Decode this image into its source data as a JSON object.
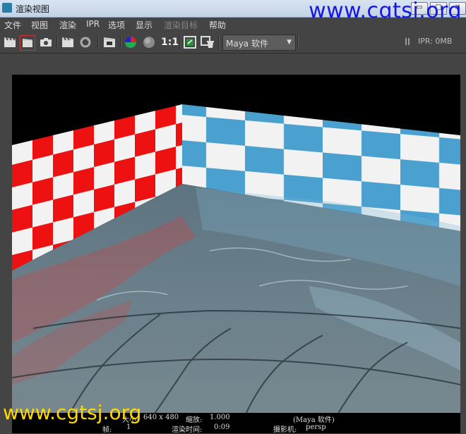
{
  "window": {
    "title": "渲染视图",
    "controls": [
      "minimize-button",
      "maximize-button",
      "close-button"
    ]
  },
  "watermark": {
    "top": "www.cgtsj.org",
    "bottom": "www.cgtsj.org"
  },
  "menu": [
    {
      "label": "文件",
      "enabled": true
    },
    {
      "label": "视图",
      "enabled": true
    },
    {
      "label": "渲染",
      "enabled": true
    },
    {
      "label": "IPR",
      "enabled": true
    },
    {
      "label": "选项",
      "enabled": true
    },
    {
      "label": "显示",
      "enabled": true
    },
    {
      "label": "渲染目标",
      "enabled": false
    },
    {
      "label": "帮助",
      "enabled": true
    }
  ],
  "toolbar": {
    "ratio_label": "1:1",
    "renderer_select": "Maya 软件",
    "ipr_status": "IPR: 0MB"
  },
  "status": {
    "size_label": "大小:",
    "size_value": "640 x 480",
    "zoom_label": "缩放:",
    "zoom_value": "1.000",
    "renderer_value": "(Maya 软件)",
    "frame_label": "帧:",
    "frame_value": "1",
    "time_label": "渲染时间:",
    "time_value": "0:09",
    "camera_label": "摄影机:",
    "camera_value": "persp"
  },
  "colors": {
    "red_tile": "#ee1111",
    "blue_tile": "#4aa0cf",
    "white_tile": "#f2f2f2",
    "water": "#6b7f8a",
    "watermark_top": "#1515e6",
    "watermark_bottom": "#ffd800"
  }
}
